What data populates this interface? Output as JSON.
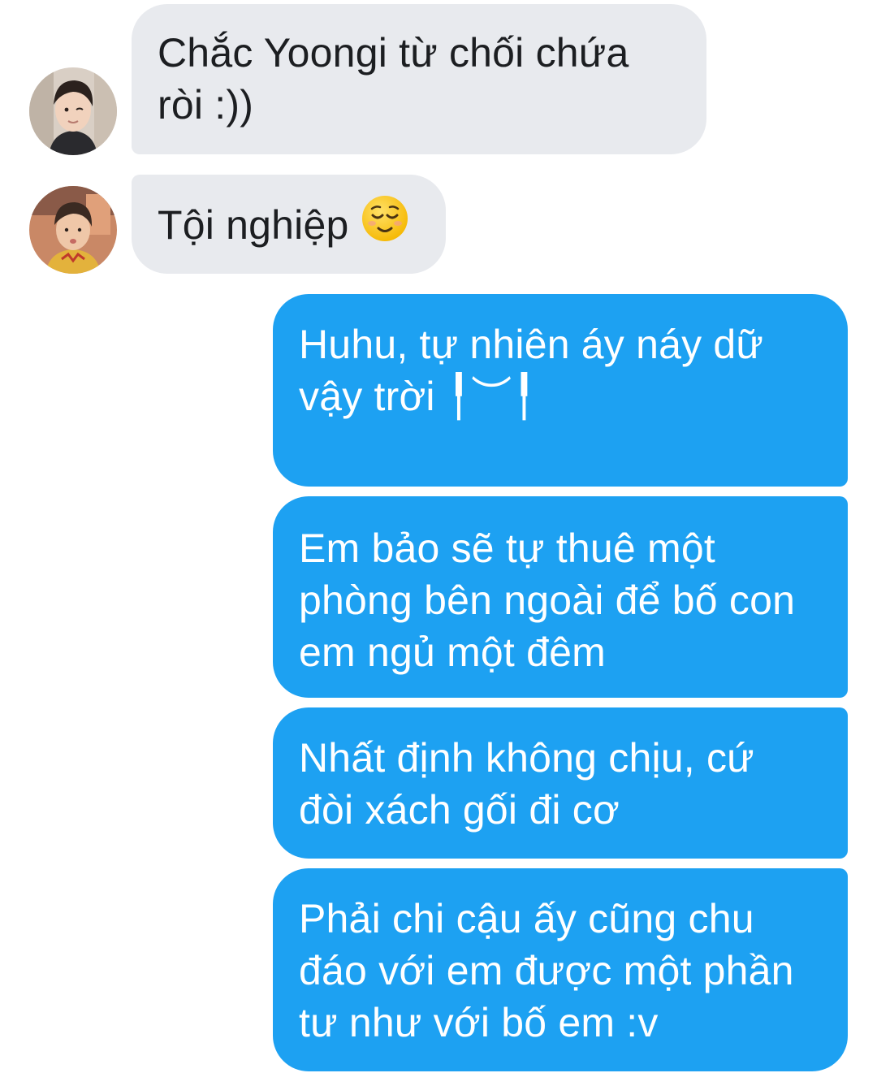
{
  "messages": [
    {
      "direction": "incoming",
      "text": "Chắc Yoongi từ chối chứa\nròi :))"
    },
    {
      "direction": "incoming",
      "text": "Tội nghiệp",
      "emoji": "relieved-face"
    },
    {
      "direction": "outgoing",
      "text": "Huhu, tự nhiên áy náy dữ\nvậy trời ╿︶╿"
    },
    {
      "direction": "outgoing",
      "text": "Em bảo sẽ tự thuê một\nphòng bên ngoài để bố con\nem ngủ một đêm"
    },
    {
      "direction": "outgoing",
      "text": "Nhất định không chịu, cứ\nđòi xách gối đi cơ"
    },
    {
      "direction": "outgoing",
      "text": "Phải chi cậu ấy cũng chu\nđáo với em được một phần\ntư như với bố em :v"
    }
  ],
  "colors": {
    "incoming_bubble": "#e8eaee",
    "outgoing_bubble": "#1da1f2",
    "incoming_text": "#1c1e21",
    "outgoing_text": "#ffffff"
  }
}
